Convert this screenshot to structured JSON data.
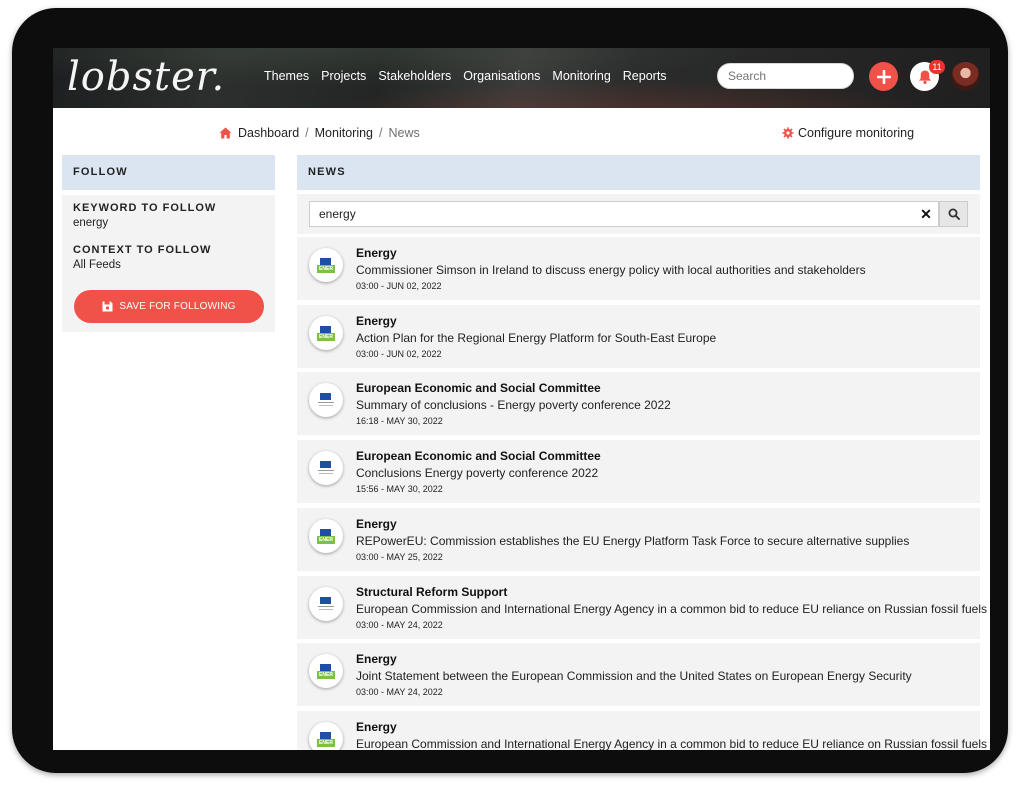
{
  "header": {
    "logo": "lobster.",
    "nav": [
      "Themes",
      "Projects",
      "Stakeholders",
      "Organisations",
      "Monitoring",
      "Reports"
    ],
    "search_placeholder": "Search",
    "notification_count": "11",
    "add_icon": "plus-icon",
    "bell_icon": "bell-icon"
  },
  "breadcrumb": {
    "home": "Dashboard",
    "sep": "/",
    "monitoring": "Monitoring",
    "current": "News"
  },
  "configure_label": "Configure monitoring",
  "follow": {
    "heading": "FOLLOW",
    "keyword_label": "KEYWORD TO FOLLOW",
    "keyword_value": "energy",
    "context_label": "CONTEXT TO FOLLOW",
    "context_value": "All Feeds",
    "save_label": "SAVE FOR FOLLOWING"
  },
  "news": {
    "heading": "NEWS",
    "search_value": "energy",
    "items": [
      {
        "source": "Energy",
        "title": "Commissioner Simson in Ireland to discuss energy policy with local authorities and stakeholders",
        "date": "03:00 - JUN 02, 2022",
        "logo": "ener"
      },
      {
        "source": "Energy",
        "title": "Action Plan for the Regional Energy Platform for South-East Europe",
        "date": "03:00 - JUN 02, 2022",
        "logo": "ener"
      },
      {
        "source": "European Economic and Social Committee",
        "title": "Summary of conclusions - Energy poverty conference 2022",
        "date": "16:18 - MAY 30, 2022",
        "logo": "ec"
      },
      {
        "source": "European Economic and Social Committee",
        "title": "Conclusions Energy poverty conference 2022",
        "date": "15:56 - MAY 30, 2022",
        "logo": "ec"
      },
      {
        "source": "Energy",
        "title": "REPowerEU: Commission establishes the EU Energy Platform Task Force to secure alternative supplies",
        "date": "03:00 - MAY 25, 2022",
        "logo": "ener"
      },
      {
        "source": "Structural Reform Support",
        "title": "European Commission and International Energy Agency in a common bid to reduce EU reliance on Russian fossil fuels",
        "date": "03:00 - MAY 24, 2022",
        "logo": "ec"
      },
      {
        "source": "Energy",
        "title": "Joint Statement between the European Commission and the United States on European Energy Security",
        "date": "03:00 - MAY 24, 2022",
        "logo": "ener"
      },
      {
        "source": "Energy",
        "title": "European Commission and International Energy Agency in a common bid to reduce EU reliance on Russian fossil fuels",
        "date": "",
        "logo": "ener"
      }
    ]
  },
  "colors": {
    "accent": "#f0524a",
    "panel_header": "#dbe5f1",
    "panel_bg": "#f3f3f3",
    "ener_green": "#7cc242",
    "eu_blue": "#1f4fa3"
  }
}
